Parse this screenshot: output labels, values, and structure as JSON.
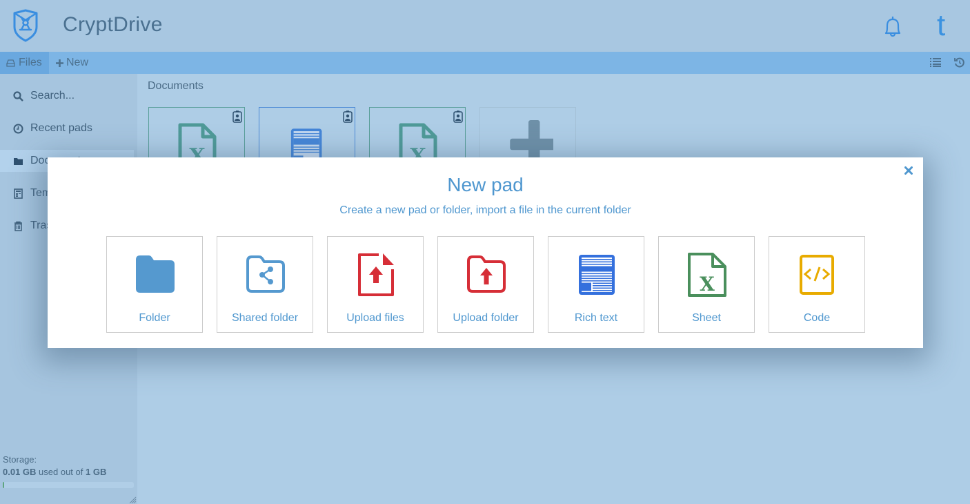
{
  "header": {
    "app_title": "CryptDrive",
    "logo_icon": "cryptpad-shield-logo",
    "notification_icon": "bell-icon",
    "user_avatar_letter": "t"
  },
  "toolbar": {
    "files_label": "Files",
    "new_label": "New",
    "list_view_icon": "list-icon",
    "history_icon": "history-icon"
  },
  "sidebar": {
    "items": [
      {
        "label": "Search...",
        "icon": "search-icon"
      },
      {
        "label": "Recent pads",
        "icon": "clock-icon"
      },
      {
        "label": "Documents",
        "icon": "folder-open-icon",
        "active": true
      },
      {
        "label": "Templates",
        "icon": "template-icon"
      },
      {
        "label": "Trash",
        "icon": "trash-icon"
      }
    ],
    "storage": {
      "label": "Storage:",
      "used": "0.01 GB",
      "middle": "used out of",
      "total": "1 GB",
      "fraction_used": 0.01
    }
  },
  "main": {
    "breadcrumb": "Documents",
    "tiles": [
      {
        "type": "sheet",
        "icon": "sheet-icon",
        "badge": "owner-badge-icon"
      },
      {
        "type": "rich-text",
        "icon": "rich-text-icon",
        "badge": "owner-badge-icon"
      },
      {
        "type": "sheet",
        "icon": "sheet-icon",
        "badge": "owner-badge-icon"
      },
      {
        "type": "add",
        "icon": "plus-icon"
      }
    ]
  },
  "modal": {
    "title": "New pad",
    "subtitle": "Create a new pad or folder, import a file in the current folder",
    "close_icon": "close-icon",
    "options": [
      {
        "label": "Folder",
        "icon": "folder-icon",
        "color": "#5599cf"
      },
      {
        "label": "Shared folder",
        "icon": "shared-folder-icon",
        "color": "#5599cf"
      },
      {
        "label": "Upload files",
        "icon": "upload-file-icon",
        "color": "#d62e37"
      },
      {
        "label": "Upload folder",
        "icon": "upload-folder-icon",
        "color": "#d62e37"
      },
      {
        "label": "Rich text",
        "icon": "rich-text-icon",
        "color": "#3470dd"
      },
      {
        "label": "Sheet",
        "icon": "sheet-icon",
        "color": "#4a8f5c"
      },
      {
        "label": "Code",
        "icon": "code-icon",
        "color": "#e8ab00"
      }
    ]
  },
  "colors": {
    "accent": "#4f97cf",
    "toolbar": "#7db5e5",
    "upload": "#d62e37",
    "rich_text": "#3470dd",
    "sheet": "#4a8f5c",
    "code": "#e8ab00"
  }
}
